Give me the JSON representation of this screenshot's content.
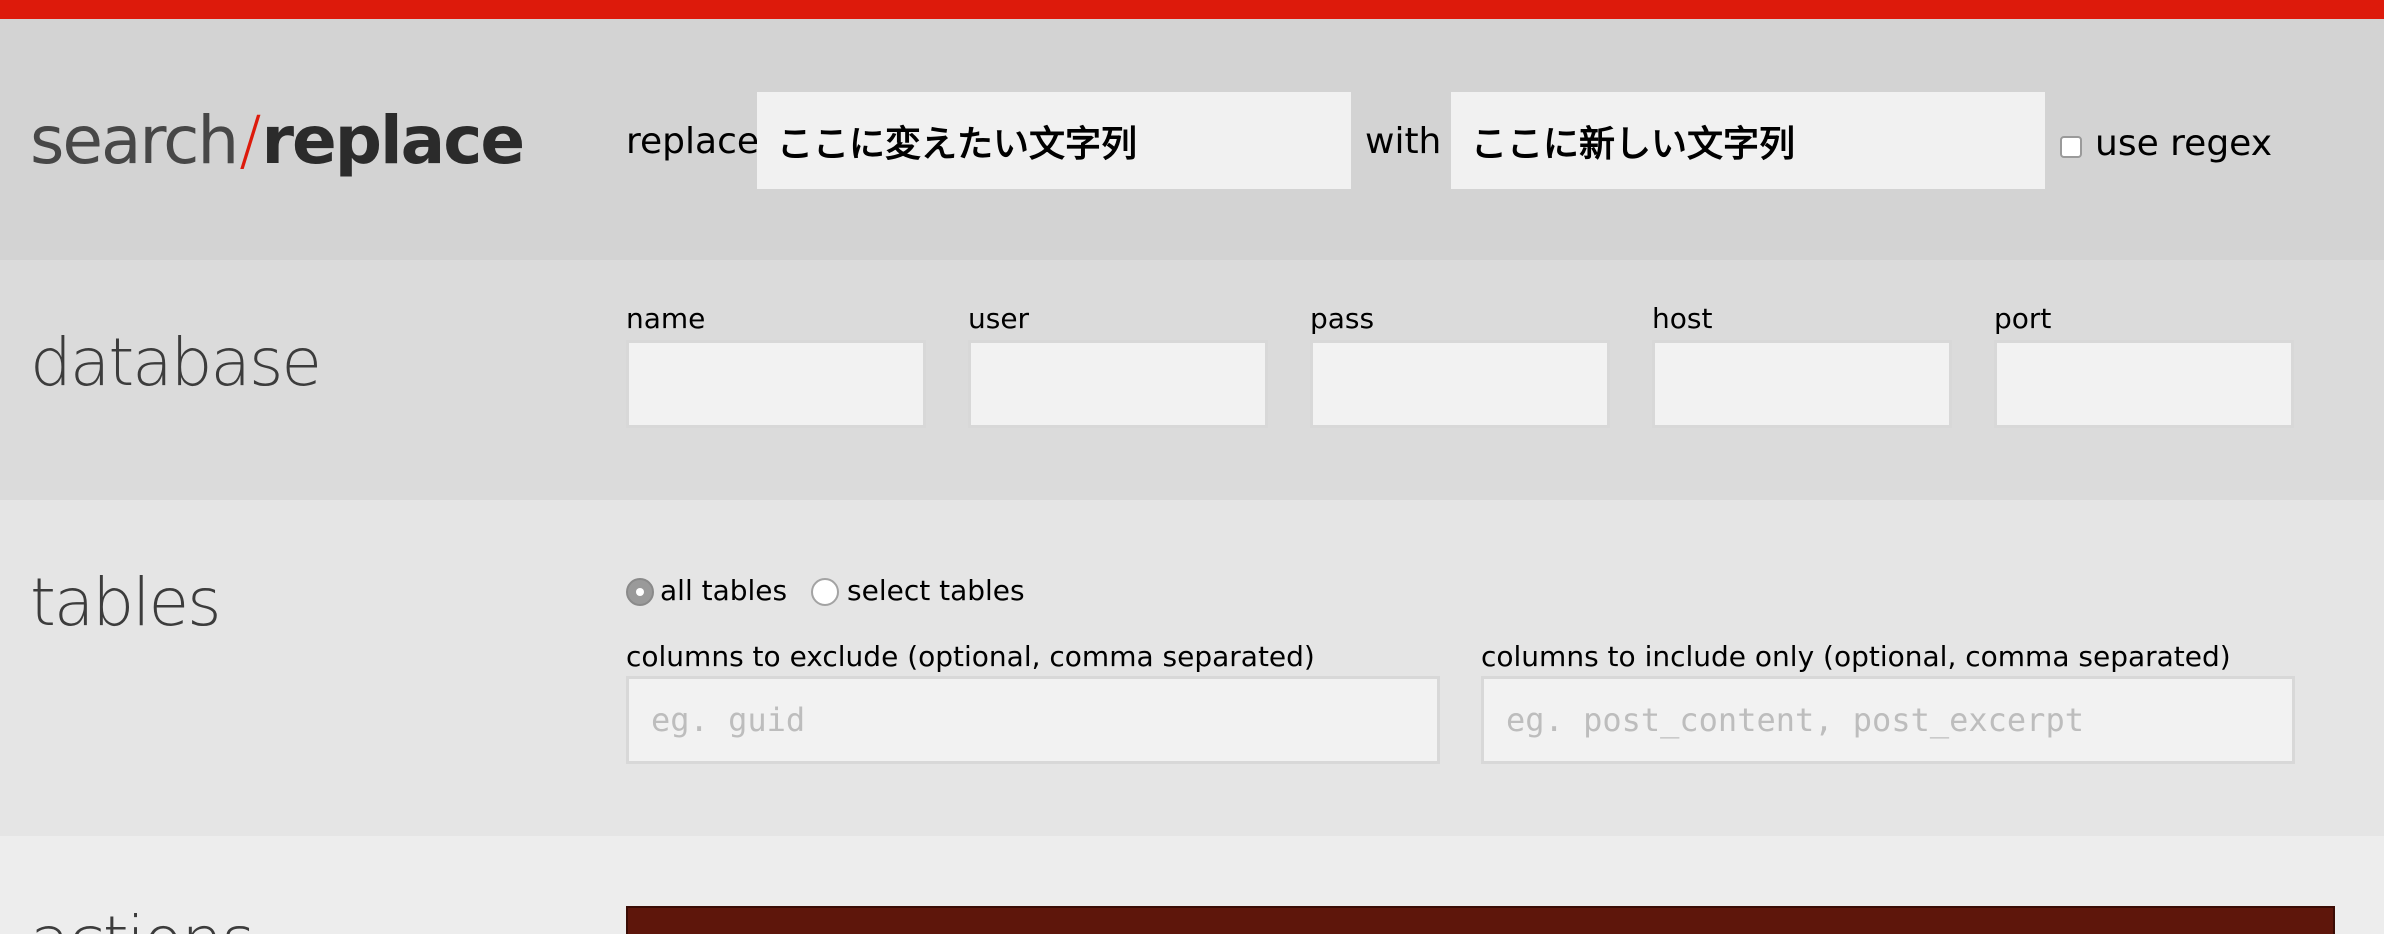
{
  "brand": {
    "title_search": "search",
    "title_slash": "/",
    "title_replace": "replace",
    "accent_color": "#dd1a0b"
  },
  "search_replace": {
    "replace_label": "replace",
    "replace_value": "ここに変えたい文字列",
    "with_label": "with",
    "with_value": "ここに新しい文字列",
    "regex_label": "use regex",
    "regex_checked": false
  },
  "database": {
    "title": "database",
    "fields": {
      "name": {
        "label": "name",
        "value": ""
      },
      "user": {
        "label": "user",
        "value": ""
      },
      "pass": {
        "label": "pass",
        "value": ""
      },
      "host": {
        "label": "host",
        "value": ""
      },
      "port": {
        "label": "port",
        "value": ""
      }
    }
  },
  "tables": {
    "title": "tables",
    "all_tables_label": "all tables",
    "select_tables_label": "select tables",
    "selected": "all tables",
    "exclude_label": "columns to exclude (optional, comma separated)",
    "exclude_placeholder": "eg. guid",
    "include_label": "columns to include only (optional, comma separated)",
    "include_placeholder": "eg. post_content, post_excerpt"
  },
  "actions": {
    "title": "actions",
    "button_color": "#5e160b"
  }
}
